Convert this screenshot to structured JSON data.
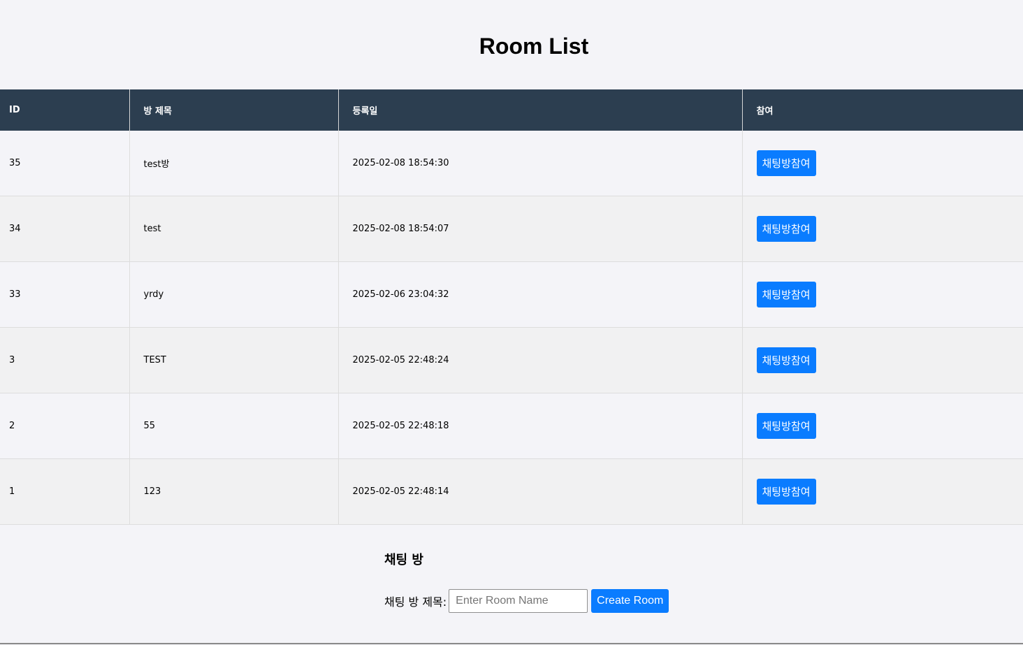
{
  "page": {
    "title": "Room List"
  },
  "table": {
    "headers": [
      "ID",
      "방 제목",
      "등록일",
      "참여"
    ],
    "rows": [
      {
        "id": "35",
        "title": "test방",
        "date": "2025-02-08 18:54:30",
        "action": "채팅방참여"
      },
      {
        "id": "34",
        "title": "test",
        "date": "2025-02-08 18:54:07",
        "action": "채팅방참여"
      },
      {
        "id": "33",
        "title": "yrdy",
        "date": "2025-02-06 23:04:32",
        "action": "채팅방참여"
      },
      {
        "id": "3",
        "title": "TEST",
        "date": "2025-02-05 22:48:24",
        "action": "채팅방참여"
      },
      {
        "id": "2",
        "title": "55",
        "date": "2025-02-05 22:48:18",
        "action": "채팅방참여"
      },
      {
        "id": "1",
        "title": "123",
        "date": "2025-02-05 22:48:14",
        "action": "채팅방참여"
      }
    ]
  },
  "create": {
    "heading": "채팅 방",
    "label": "채팅 방 제목:",
    "input_value": "",
    "input_placeholder": "Enter Room Name",
    "button_label": "Create Room"
  },
  "colors": {
    "header_bg": "#2c3e50",
    "button_bg": "#0a7cff",
    "page_bg": "#f4f4f8"
  }
}
